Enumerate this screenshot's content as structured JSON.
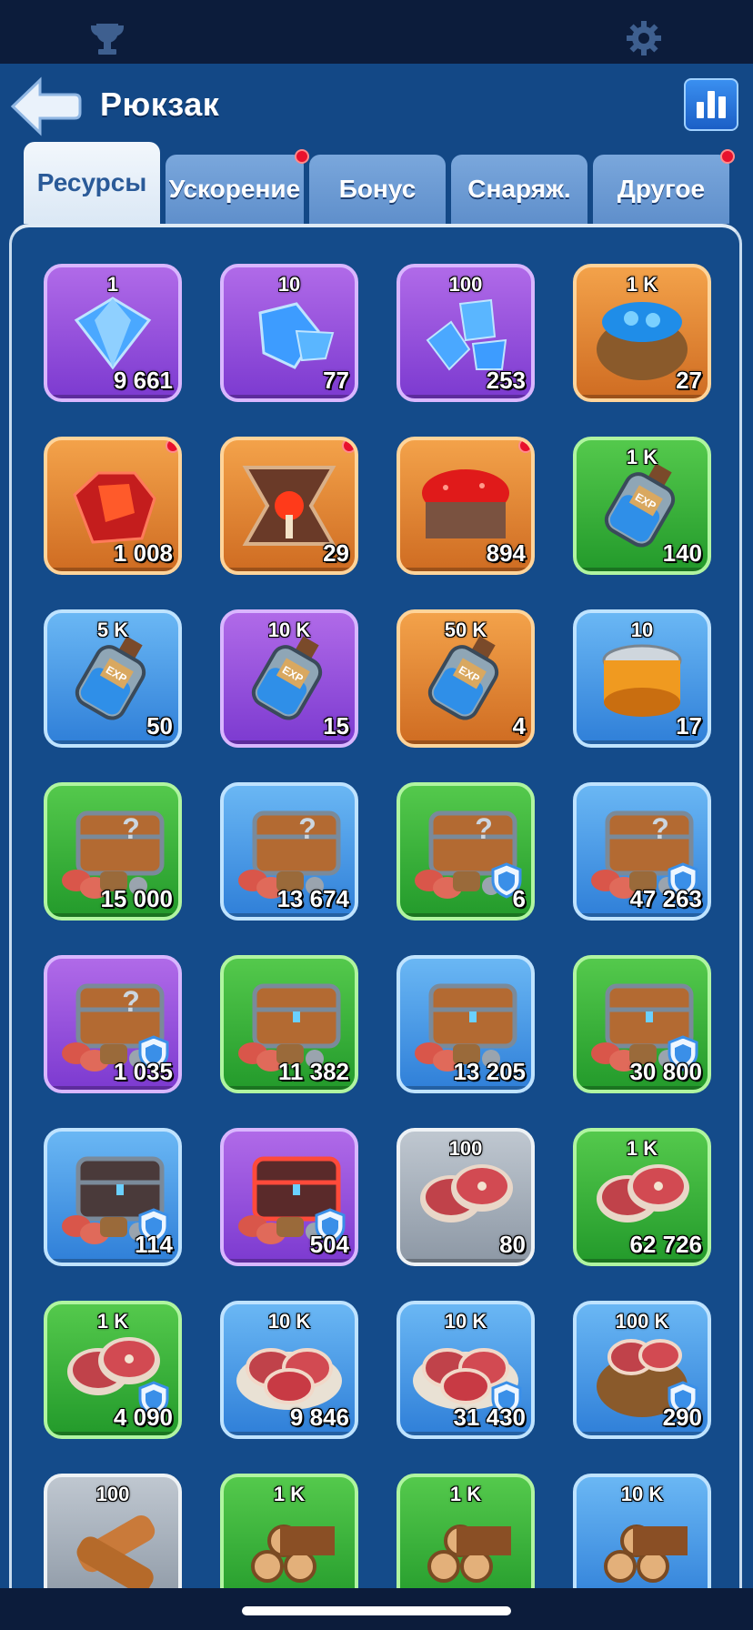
{
  "app": {
    "title": "Рюкзак"
  },
  "tabs": [
    {
      "label": "Ресурсы",
      "active": true,
      "badge": false
    },
    {
      "label": "Ускорение",
      "active": false,
      "badge": true
    },
    {
      "label": "Бонус",
      "active": false,
      "badge": false
    },
    {
      "label": "Снаряж.",
      "active": false,
      "badge": false
    },
    {
      "label": "Другое",
      "active": false,
      "badge": true
    }
  ],
  "icons": {
    "top_left": "trophy-icon",
    "top_right": "gear-icon",
    "back": "back-arrow-icon",
    "stats": "bar-chart-icon"
  },
  "colors": {
    "purple": "#9a55e0",
    "orange": "#e68a37",
    "green": "#3cb43c",
    "blue": "#4a9ce8",
    "gray": "#a6b0bb",
    "badge": "#e8112d"
  },
  "items": [
    {
      "label": "1",
      "count": "9 661",
      "rarity": "purple",
      "icon": "gem-icon",
      "badge": false,
      "shield": false
    },
    {
      "label": "10",
      "count": "77",
      "rarity": "purple",
      "icon": "gems-icon",
      "badge": false,
      "shield": false
    },
    {
      "label": "100",
      "count": "253",
      "rarity": "purple",
      "icon": "gem-pile-icon",
      "badge": false,
      "shield": false
    },
    {
      "label": "1 K",
      "count": "27",
      "rarity": "orange",
      "icon": "gem-sack-icon",
      "badge": false,
      "shield": false
    },
    {
      "label": "",
      "count": "1 008",
      "rarity": "orange",
      "icon": "red-crystal-icon",
      "badge": true,
      "shield": false
    },
    {
      "label": "",
      "count": "29",
      "rarity": "orange",
      "icon": "altar-icon",
      "badge": true,
      "shield": false
    },
    {
      "label": "",
      "count": "894",
      "rarity": "orange",
      "icon": "ore-cart-icon",
      "badge": true,
      "shield": false
    },
    {
      "label": "1 K",
      "count": "140",
      "rarity": "green",
      "icon": "exp-bottle-icon",
      "badge": false,
      "shield": false
    },
    {
      "label": "5 K",
      "count": "50",
      "rarity": "blue",
      "icon": "exp-bottle-icon",
      "badge": false,
      "shield": false
    },
    {
      "label": "10 K",
      "count": "15",
      "rarity": "purple",
      "icon": "exp-bottle-icon",
      "badge": false,
      "shield": false
    },
    {
      "label": "50 K",
      "count": "4",
      "rarity": "orange",
      "icon": "exp-bottle-icon",
      "badge": false,
      "shield": false
    },
    {
      "label": "10",
      "count": "17",
      "rarity": "blue",
      "icon": "can-icon",
      "badge": false,
      "shield": false
    },
    {
      "label": "",
      "count": "15 000",
      "rarity": "green",
      "icon": "mystery-chest-icon",
      "badge": false,
      "shield": false
    },
    {
      "label": "",
      "count": "13 674",
      "rarity": "blue",
      "icon": "mystery-chest-icon",
      "badge": false,
      "shield": false
    },
    {
      "label": "",
      "count": "6",
      "rarity": "green",
      "icon": "mystery-chest-icon",
      "badge": false,
      "shield": true
    },
    {
      "label": "",
      "count": "47 263",
      "rarity": "blue",
      "icon": "mystery-chest-icon",
      "badge": false,
      "shield": true
    },
    {
      "label": "",
      "count": "1 035",
      "rarity": "purple",
      "icon": "mystery-chest-icon",
      "badge": false,
      "shield": true
    },
    {
      "label": "",
      "count": "11 382",
      "rarity": "green",
      "icon": "chest-icon",
      "badge": false,
      "shield": false
    },
    {
      "label": "",
      "count": "13 205",
      "rarity": "blue",
      "icon": "chest-icon",
      "badge": false,
      "shield": false
    },
    {
      "label": "",
      "count": "30 800",
      "rarity": "green",
      "icon": "chest-icon",
      "badge": false,
      "shield": true
    },
    {
      "label": "",
      "count": "114",
      "rarity": "blue",
      "icon": "dark-chest-icon",
      "badge": false,
      "shield": true
    },
    {
      "label": "",
      "count": "504",
      "rarity": "purple",
      "icon": "red-chest-icon",
      "badge": false,
      "shield": true
    },
    {
      "label": "100",
      "count": "80",
      "rarity": "gray",
      "icon": "meat-icon",
      "badge": false,
      "shield": false
    },
    {
      "label": "1 K",
      "count": "62 726",
      "rarity": "green",
      "icon": "meat-icon",
      "badge": false,
      "shield": false
    },
    {
      "label": "1 K",
      "count": "4 090",
      "rarity": "green",
      "icon": "meat-icon",
      "badge": false,
      "shield": true
    },
    {
      "label": "10 K",
      "count": "9 846",
      "rarity": "blue",
      "icon": "meat-plate-icon",
      "badge": false,
      "shield": false
    },
    {
      "label": "10 K",
      "count": "31 430",
      "rarity": "blue",
      "icon": "meat-plate-icon",
      "badge": false,
      "shield": true
    },
    {
      "label": "100 K",
      "count": "290",
      "rarity": "blue",
      "icon": "meat-sack-icon",
      "badge": false,
      "shield": true
    },
    {
      "label": "100",
      "count": "",
      "rarity": "gray",
      "icon": "wood-icon",
      "badge": false,
      "shield": false
    },
    {
      "label": "1 K",
      "count": "",
      "rarity": "green",
      "icon": "log-pile-icon",
      "badge": false,
      "shield": false
    },
    {
      "label": "1 K",
      "count": "",
      "rarity": "green",
      "icon": "log-pile-icon",
      "badge": false,
      "shield": false
    },
    {
      "label": "10 K",
      "count": "",
      "rarity": "blue",
      "icon": "log-pile-icon",
      "badge": false,
      "shield": false
    }
  ]
}
